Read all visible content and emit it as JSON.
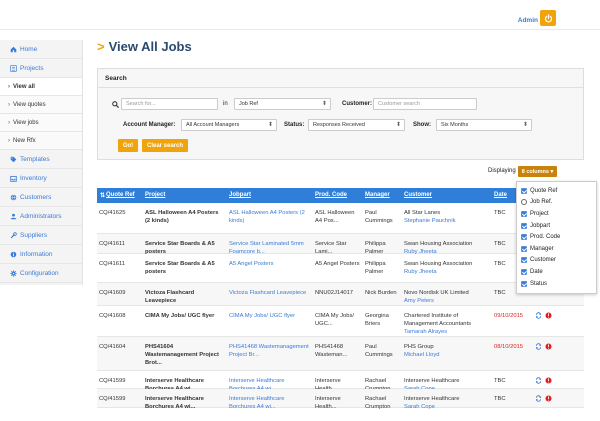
{
  "header": {
    "admin": "Admin"
  },
  "sidebar": {
    "items": [
      {
        "label": "Home",
        "icon": "home-icon"
      },
      {
        "label": "Projects",
        "icon": "list-icon"
      },
      {
        "label": "View all",
        "sub": true,
        "active": true
      },
      {
        "label": "View quotes",
        "sub": true
      },
      {
        "label": "View jobs",
        "sub": true
      },
      {
        "label": "New Rfx",
        "sub": true
      },
      {
        "label": "Templates",
        "icon": "tag-icon"
      },
      {
        "label": "Inventory",
        "icon": "inbox-icon"
      },
      {
        "label": "Customers",
        "icon": "globe-icon"
      },
      {
        "label": "Administrators",
        "icon": "user-icon"
      },
      {
        "label": "Suppliers",
        "icon": "wrench-icon"
      },
      {
        "label": "Information",
        "icon": "info-icon"
      },
      {
        "label": "Configuration",
        "icon": "gear-icon"
      }
    ]
  },
  "page": {
    "title": "View All Jobs"
  },
  "search": {
    "header": "Search",
    "placeholder": "Search for...",
    "in_label": "in",
    "in_value": "Job Ref",
    "customer_label": "Customer:",
    "customer_placeholder": "Customer search",
    "account_manager_label": "Account Manager:",
    "account_manager_value": "All Account Managers",
    "status_label": "Status:",
    "status_value": "Responses Received",
    "show_label": "Show:",
    "show_value": "Six Months",
    "go_label": "Go!",
    "clear_label": "Clear search"
  },
  "displaying": {
    "label": "Displaying",
    "columns_button": "8 columns ▾"
  },
  "table": {
    "headers": [
      "Quote Ref",
      "Project",
      "Jobpart",
      "Prod. Code",
      "Manager",
      "Customer",
      "Date"
    ],
    "rows": [
      {
        "quote": "CQ/41625",
        "project": "ASL Halloween A4 Posters (2 kinds)",
        "jobpart": "ASL Halloween A4 Posters (2 kinds)",
        "code": "ASL Halloween A4 Pos...",
        "manager": "Paul Cummings",
        "customer": "All Star Lanes",
        "contact": "Stephanie Pauchnik",
        "date": "TBC",
        "icons": false
      },
      {
        "quote": "CQ/41611",
        "project": "Service Star Boards & A5 posters",
        "jobpart": "Service Star Laminated 5mm Foamcore b...",
        "code": "Service Star Lami...",
        "manager": "Philippa Palmer",
        "customer": "Swan Housing Association",
        "contact": "Ruby Jheeta",
        "date": "TBC",
        "icons": false
      },
      {
        "quote": "CQ/41611",
        "project": "Service Star Boards & A5 posters",
        "jobpart": "A5 Angel Posters",
        "code": "A5 Angel Posters",
        "manager": "Philippa Palmer",
        "customer": "Swan Housing Association",
        "contact": "Ruby Jheeta",
        "date": "TBC",
        "icons": false
      },
      {
        "quote": "CQ/41609",
        "project": "Victoza Flashcard Leavepiece",
        "jobpart": "Victoza Flashcard Leavepiece",
        "code": "NNU02J14017",
        "manager": "Nick Burden",
        "customer": "Novo Nordisk UK Limited",
        "contact": "Amy Peters",
        "date": "TBC",
        "icons": false
      },
      {
        "quote": "CQ/41608",
        "project": "CIMA My Jobs/ UGC flyer",
        "jobpart": "CIMA My Jobs/ UGC flyer",
        "code": "CIMA My Jobs/ UGC...",
        "manager": "Georgina Briers",
        "customer": "Chartered Institute of Management Accountants",
        "contact": "Tamarah Alrayes",
        "date": "09/10/2015",
        "icons": true
      },
      {
        "quote": "CQ/41604",
        "project": "PHS41604 Wastemanagement Project Brot...",
        "jobpart": "PHS41468 Wastemanagement Project Br...",
        "code": "PHS41468 Wasteman...",
        "manager": "Paul Cummings",
        "customer": "PHS Group",
        "contact": "Michael Lloyd",
        "date": "08/10/2015",
        "icons": true
      },
      {
        "quote": "CQ/41599",
        "project": "Interserve Healthcare Borchures A4 wi...",
        "jobpart": "Interserve Healthcare Borchures A4 wi...",
        "code": "Interserve Health...",
        "manager": "Rachael Crumpton",
        "customer": "Interserve Healthcare",
        "contact": "Sarah Cope",
        "date": "TBC",
        "icons": true
      },
      {
        "quote": "CQ/41599",
        "project": "Interserve Healthcare Borchures A4 wi...",
        "jobpart": "Interserve Healthcare Borchures A4 wi...",
        "code": "Interserve Health...",
        "manager": "Rachael Crumpton",
        "customer": "Interserve Healthcare",
        "contact": "Sarah Cope",
        "date": "TBC",
        "icons": true
      }
    ]
  },
  "columns_menu": {
    "options": [
      {
        "label": "Quote Ref",
        "checked": true
      },
      {
        "label": "Job Ref.",
        "checked": false,
        "radio": true
      },
      {
        "label": "Project",
        "checked": true
      },
      {
        "label": "Jobpart",
        "checked": true
      },
      {
        "label": "Prod. Code",
        "checked": true
      },
      {
        "label": "Manager",
        "checked": true
      },
      {
        "label": "Customer",
        "checked": true
      },
      {
        "label": "Date",
        "checked": true
      },
      {
        "label": "Status",
        "checked": true
      }
    ]
  },
  "colors": {
    "accent": "#f0a30a",
    "header_blue": "#2f7ed8",
    "link": "#3a7bd5",
    "alert": "#e02020"
  }
}
